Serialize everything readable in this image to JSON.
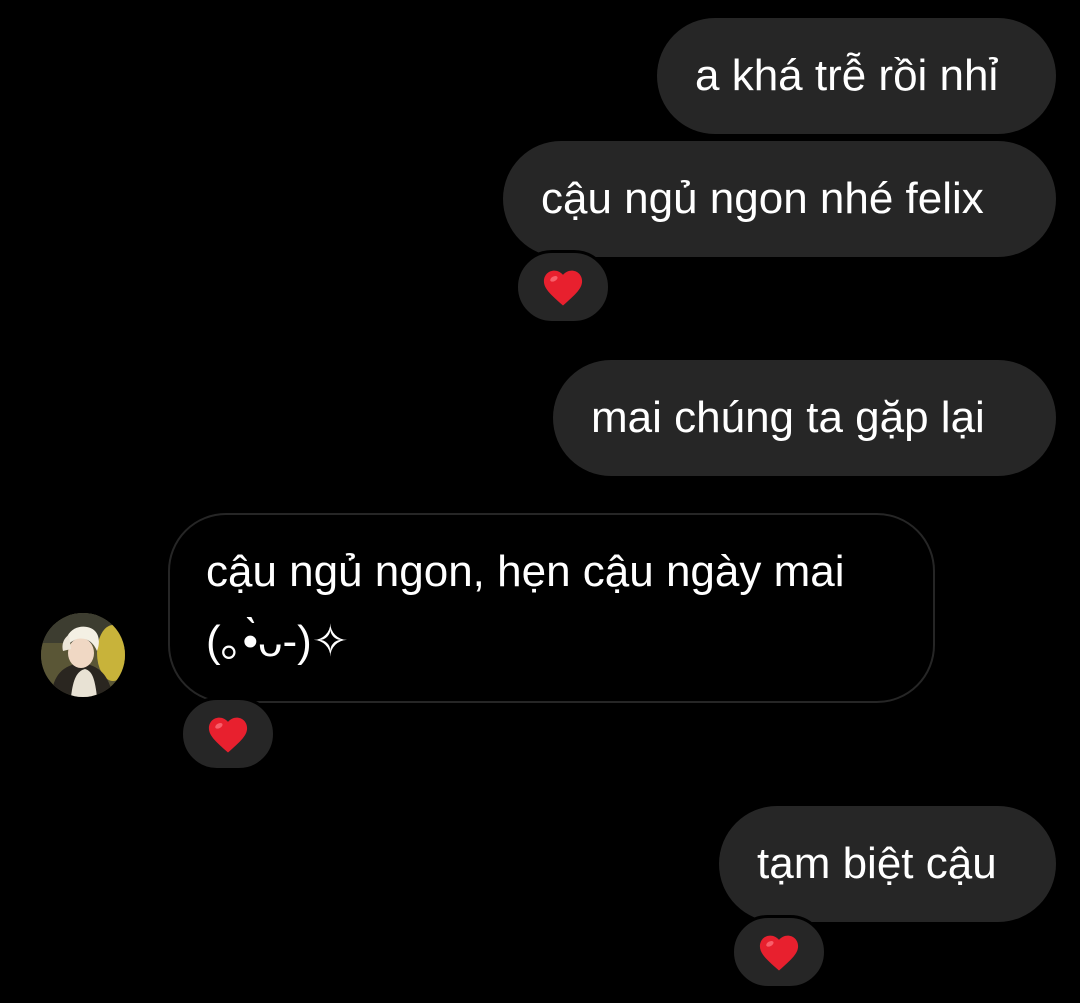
{
  "messages": [
    {
      "text": "a khá trễ rồi nhỉ"
    },
    {
      "text": "cậu ngủ ngon nhé felix",
      "reaction": "heart-icon"
    },
    {
      "text": "mai chúng ta gặp lại"
    },
    {
      "line1": "cậu ngủ ngon, hẹn cậu ngày mai",
      "line2": "(｡•̀ᴗ-)✧",
      "reaction": "heart-icon"
    },
    {
      "text": "tạm biệt cậu",
      "reaction": "heart-icon"
    }
  ],
  "colors": {
    "background": "#000000",
    "sent_bubble": "#262626",
    "received_border": "#262626",
    "text": "#ffffff",
    "heart": "#e8202e"
  }
}
